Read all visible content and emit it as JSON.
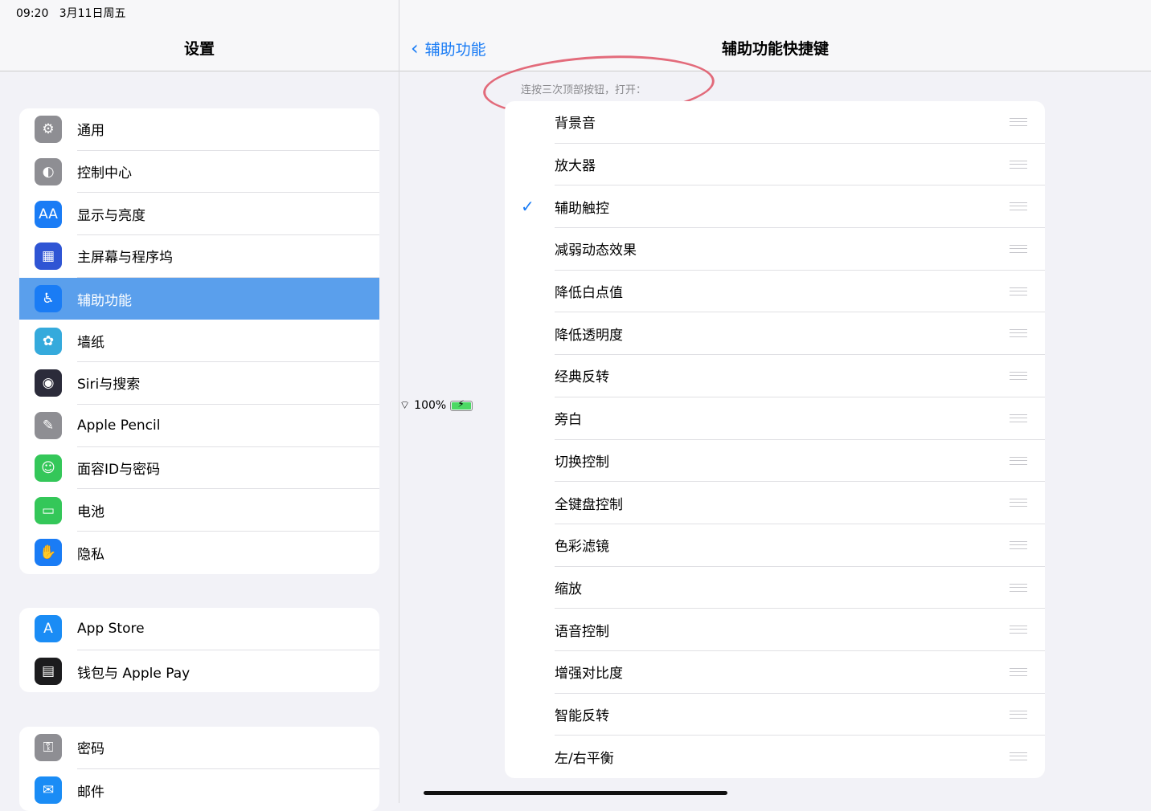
{
  "status": {
    "time": "09:20",
    "date": "3月11日周五",
    "battery": "100%",
    "battery_level": 1.0
  },
  "sidebar": {
    "title": "设置",
    "groups": [
      [
        {
          "label": "通用",
          "icon": "gear-icon",
          "color": "#8e8e93",
          "glyph": "⚙"
        },
        {
          "label": "控制中心",
          "icon": "toggle-icon",
          "color": "#8e8e93",
          "glyph": "◐"
        },
        {
          "label": "显示与亮度",
          "icon": "text-size-icon",
          "color": "#1a7cf5",
          "glyph": "AA"
        },
        {
          "label": "主屏幕与程序坞",
          "icon": "home-grid-icon",
          "color": "#2f55d4",
          "glyph": "▦"
        },
        {
          "label": "辅助功能",
          "icon": "accessibility-icon",
          "color": "#1a7cf5",
          "glyph": "♿",
          "selected": true
        },
        {
          "label": "墙纸",
          "icon": "flower-icon",
          "color": "#35aadc",
          "glyph": "✿"
        },
        {
          "label": "Siri与搜索",
          "icon": "siri-icon",
          "color": "#2b2b3a",
          "glyph": "◉"
        },
        {
          "label": "Apple Pencil",
          "icon": "pencil-icon",
          "color": "#8e8e93",
          "glyph": "✎"
        },
        {
          "label": "面容ID与密码",
          "icon": "face-id-icon",
          "color": "#34c759",
          "glyph": "☺"
        },
        {
          "label": "电池",
          "icon": "battery-icon",
          "color": "#34c759",
          "glyph": "▭"
        },
        {
          "label": "隐私",
          "icon": "hand-icon",
          "color": "#1a7cf5",
          "glyph": "✋"
        }
      ],
      [
        {
          "label": "App Store",
          "icon": "app-store-icon",
          "color": "#1a8cf5",
          "glyph": "A"
        },
        {
          "label": "钱包与 Apple Pay",
          "icon": "wallet-icon",
          "color": "#1c1c1e",
          "glyph": "▤"
        }
      ],
      [
        {
          "label": "密码",
          "icon": "key-icon",
          "color": "#8e8e93",
          "glyph": "⚿"
        },
        {
          "label": "邮件",
          "icon": "mail-icon",
          "color": "#1a8cf5",
          "glyph": "✉"
        }
      ]
    ]
  },
  "detail": {
    "back_label": "辅助功能",
    "title": "辅助功能快捷键",
    "note": "连按三次顶部按钮，打开：",
    "items": [
      {
        "label": "背景音",
        "checked": false
      },
      {
        "label": "放大器",
        "checked": false
      },
      {
        "label": "辅助触控",
        "checked": true
      },
      {
        "label": "减弱动态效果",
        "checked": false
      },
      {
        "label": "降低白点值",
        "checked": false
      },
      {
        "label": "降低透明度",
        "checked": false
      },
      {
        "label": "经典反转",
        "checked": false
      },
      {
        "label": "旁白",
        "checked": false
      },
      {
        "label": "切换控制",
        "checked": false
      },
      {
        "label": "全键盘控制",
        "checked": false
      },
      {
        "label": "色彩滤镜",
        "checked": false
      },
      {
        "label": "缩放",
        "checked": false
      },
      {
        "label": "语音控制",
        "checked": false
      },
      {
        "label": "增强对比度",
        "checked": false
      },
      {
        "label": "智能反转",
        "checked": false
      },
      {
        "label": "左/右平衡",
        "checked": false
      }
    ]
  }
}
